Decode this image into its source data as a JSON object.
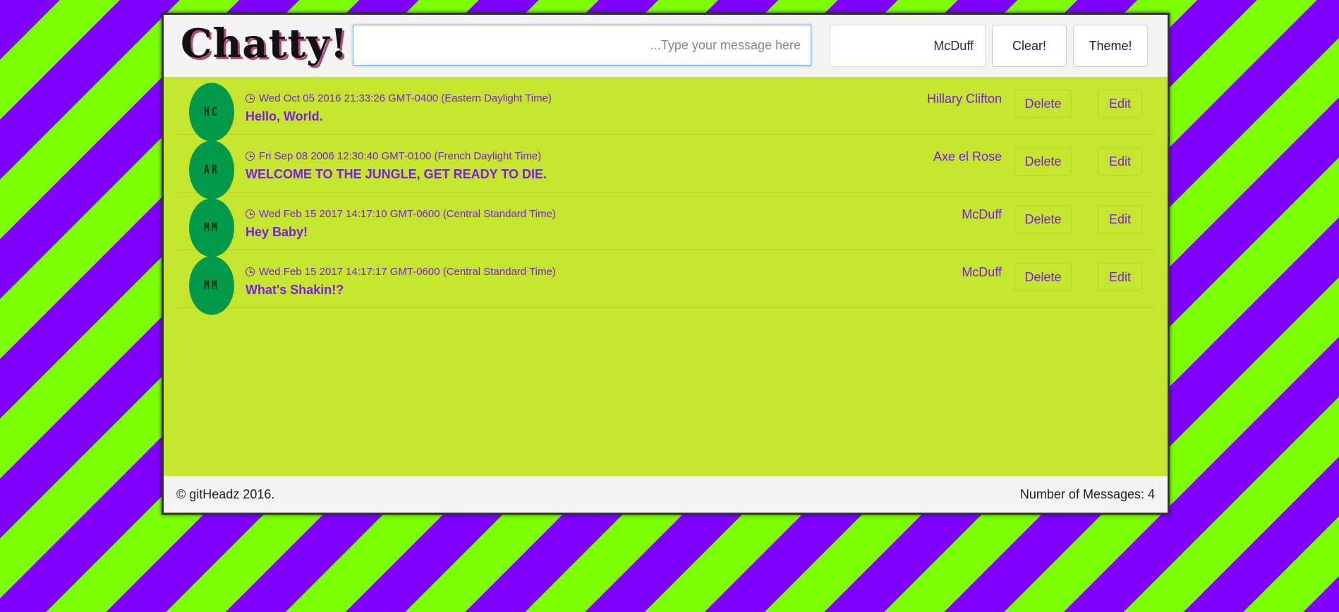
{
  "header": {
    "logo": "Chatty!",
    "message_placeholder": "...Type your message here",
    "username_value": "McDuff",
    "clear_label": "Clear!",
    "theme_label": "Theme!"
  },
  "messages": [
    {
      "initials": "HC",
      "timestamp": "Wed Oct 05 2016 21:33:26 GMT-0400 (Eastern Daylight Time)",
      "text": "Hello, World.",
      "author": "Hillary Clifton",
      "delete_label": "Delete",
      "edit_label": "Edit"
    },
    {
      "initials": "AR",
      "timestamp": "Fri Sep 08 2006 12:30:40 GMT-0100 (French Daylight Time)",
      "text": "WELCOME TO THE JUNGLE, GET READY TO DIE.",
      "author": "Axe el Rose",
      "delete_label": "Delete",
      "edit_label": "Edit"
    },
    {
      "initials": "MM",
      "timestamp": "Wed Feb 15 2017 14:17:10 GMT-0600 (Central Standard Time)",
      "text": "Hey Baby!",
      "author": "McDuff",
      "delete_label": "Delete",
      "edit_label": "Edit"
    },
    {
      "initials": "MM",
      "timestamp": "Wed Feb 15 2017 14:17:17 GMT-0600 (Central Standard Time)",
      "text": "What's Shakin!?",
      "author": "McDuff",
      "delete_label": "Delete",
      "edit_label": "Edit"
    }
  ],
  "footer": {
    "copyright": "© gitHeadz 2016.",
    "count_label": "Number of Messages: 4"
  },
  "colors": {
    "background_purple": "#7f00ff",
    "background_green": "#7cff00",
    "panel": "#c5e52e",
    "accent_text": "#7a1fe0",
    "avatar": "#009a4a"
  }
}
